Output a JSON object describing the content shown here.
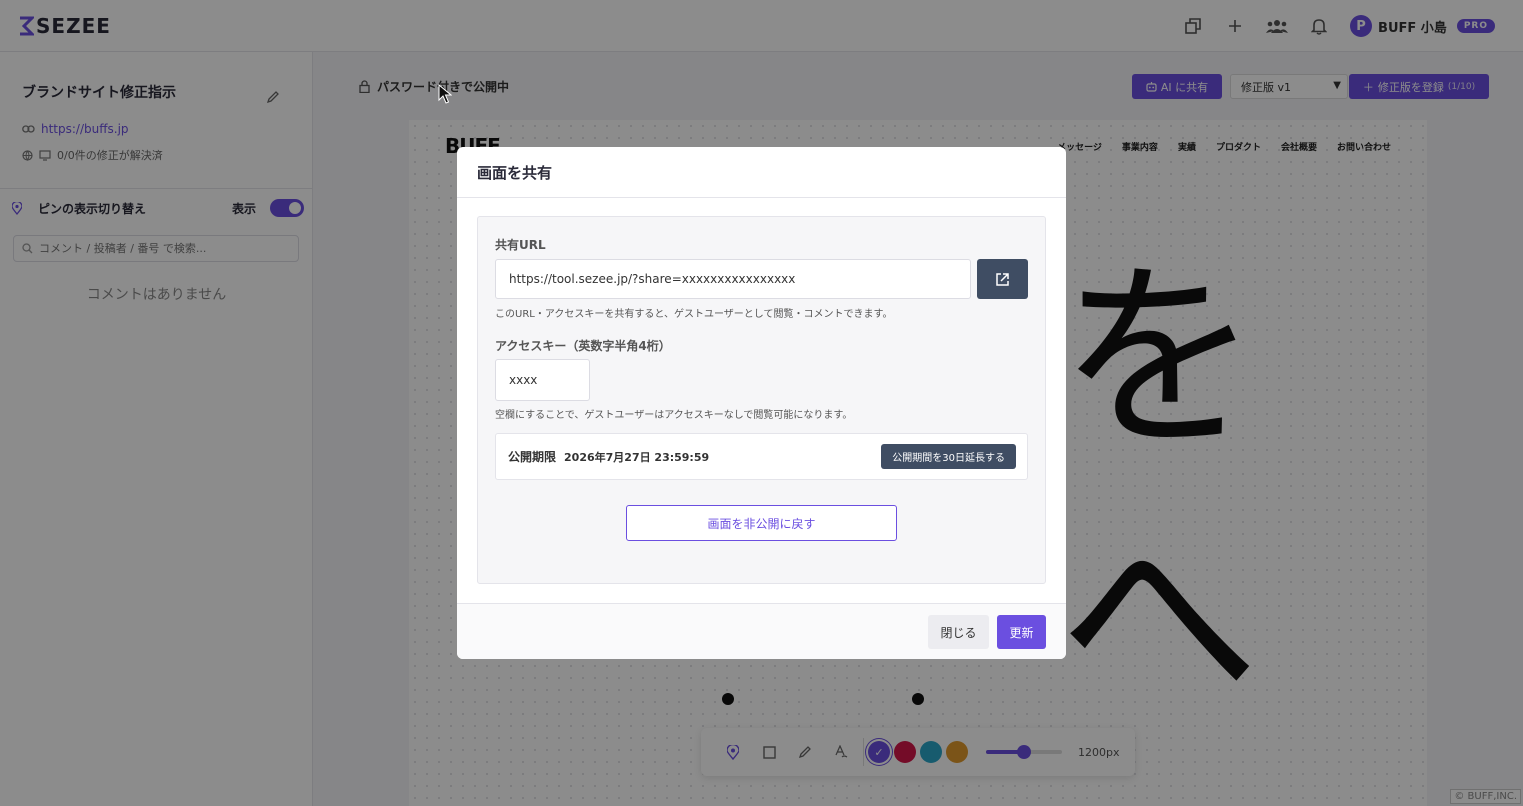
{
  "app": {
    "logo_text": "SEZEE",
    "user_initial": "P",
    "user_name": "BUFF 小島",
    "plan_badge": "PRO"
  },
  "sidebar": {
    "project_title": "ブランドサイト修正指示",
    "site_url": "https://buffs.jp",
    "resolution_status": "0/0件の修正が解決済",
    "pin_toggle_label": "ピンの表示切り替え",
    "pin_toggle_state": "表示",
    "search_placeholder": "コメント / 投稿者 / 番号 で検索...",
    "empty_text": "コメントはありません"
  },
  "main": {
    "publish_status": "パスワード付きで公開中",
    "ai_share_label": "AI に共有",
    "version_selected": "修正版 v1",
    "register_label": "修正版を登録",
    "register_count": "(1/10)"
  },
  "canvas": {
    "site_logo": "BUFF",
    "nav": [
      "メッセージ",
      "事業内容",
      "実績",
      "プロダクト",
      "会社概要",
      "お問い合わせ"
    ],
    "char1": "を",
    "char2": "へ"
  },
  "toolbar": {
    "colors": [
      "#6b4fe0",
      "#d4174a",
      "#2aa6c9",
      "#e09a2c"
    ],
    "width_value": "1200px",
    "slider_fraction": 0.5
  },
  "footer": {
    "copyright": "© BUFF,INC."
  },
  "modal": {
    "title": "画面を共有",
    "share_url_label": "共有URL",
    "share_url": "https://tool.sezee.jp/?share=xxxxxxxxxxxxxxxx",
    "share_url_help": "このURL・アクセスキーを共有すると、ゲストユーザーとして閲覧・コメントできます。",
    "access_key_label": "アクセスキー（英数字半角4桁）",
    "access_key_value": "xxxx",
    "access_key_help": "空欄にすることで、ゲストユーザーはアクセスキーなしで閲覧可能になります。",
    "expiry_label": "公開期限",
    "expiry_value": "2026年7月27日 23:59:59",
    "extend_label": "公開期間を30日延長する",
    "unpublish_label": "画面を非公開に戻す",
    "close_label": "閉じる",
    "update_label": "更新"
  }
}
